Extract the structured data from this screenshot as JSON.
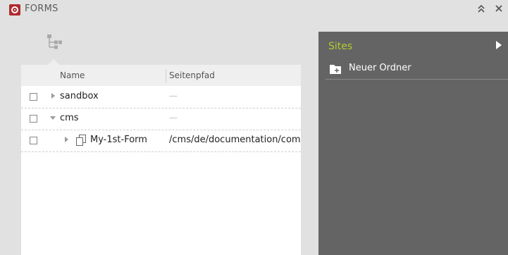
{
  "window": {
    "title": "FORMS",
    "icons": {
      "app": "forms-app-icon",
      "collapse": "double-chevron-up-icon",
      "close": "close-icon",
      "tree": "tree-structure-icon"
    }
  },
  "list": {
    "columns": {
      "name": "Name",
      "path": "Seitenpfad"
    },
    "rows": [
      {
        "label": "sandbox",
        "path": "—",
        "expanded": false
      },
      {
        "label": "cms",
        "path": "—",
        "expanded": true
      },
      {
        "label": "My-1st-Form",
        "path": "/cms/de/documentation/components",
        "icon": "copy-document-icon"
      }
    ]
  },
  "side_panel": {
    "title": "Sites",
    "items": [
      {
        "label": "Neuer Ordner",
        "icon": "new-folder-icon"
      }
    ]
  },
  "colors": {
    "accent_green": "#b4cc2e",
    "brand_red": "#b02a2e",
    "panel_dark": "#646464",
    "background": "#e1e1e1"
  }
}
